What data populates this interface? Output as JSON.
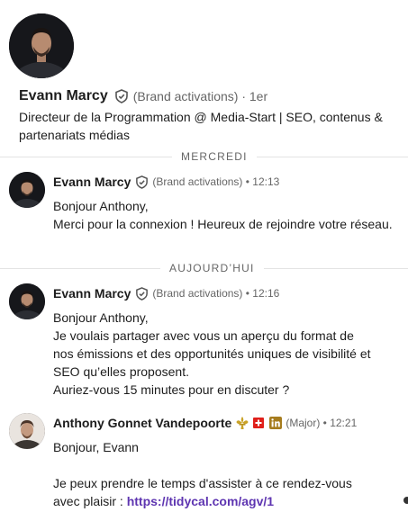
{
  "profile": {
    "name": "Evann Marcy",
    "meta": "(Brand activations) · 1er",
    "headline": "Directeur de la Programmation @ Media-Start | SEO, contenus & partenariats médias"
  },
  "dividers": {
    "first": "MERCREDI",
    "second": "AUJOURD’HUI"
  },
  "messages": [
    {
      "sender": "Evann Marcy",
      "meta": "(Brand activations) • 12:13",
      "lines": [
        "Bonjour Anthony,",
        "Merci pour la connexion ! Heureux de rejoindre votre réseau."
      ]
    },
    {
      "sender": "Evann Marcy",
      "meta": "(Brand activations) • 12:16",
      "lines": [
        "Bonjour Anthony,",
        "Je voulais partager avec vous un aperçu du format de nos émissions et des opportunités uniques de visibilité et SEO qu’elles proposent.",
        "Auriez-vous 15 minutes pour en discuter ?"
      ]
    },
    {
      "sender": "Anthony Gonnet Vandepoorte",
      "meta": "(Major) • 12:21",
      "lines": [
        "Bonjour, Evann",
        "Je peux prendre le temps d'assister à ce rendez-vous avec plaisir : "
      ],
      "link": "https://tidycal.com/agv/1"
    }
  ],
  "icons": {
    "verified": "shield-check-icon",
    "badges": [
      "fleur-de-lis-icon",
      "swiss-flag-icon",
      "linkedin-icon"
    ]
  },
  "colors": {
    "link": "#5e35b1",
    "secondary_text": "#666666",
    "linkedin_badge": "#a67c1e",
    "swiss_red": "#e0201b"
  }
}
